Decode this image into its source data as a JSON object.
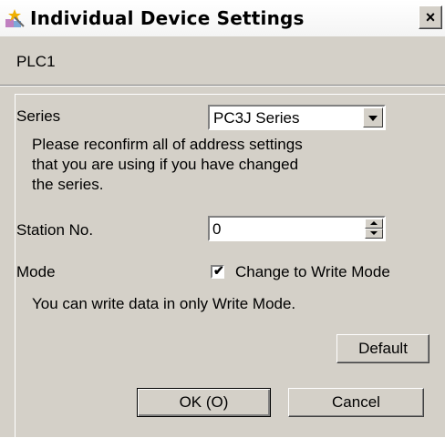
{
  "window": {
    "title": "Individual Device Settings",
    "close_glyph": "×"
  },
  "device": {
    "name": "PLC1"
  },
  "series": {
    "label": "Series",
    "selected": "PC3J Series",
    "note_lines": [
      "Please reconfirm all of address settings",
      "that you are using if you have changed",
      "the series."
    ]
  },
  "station": {
    "label": "Station No.",
    "value": "0"
  },
  "mode": {
    "label": "Mode",
    "checkbox_label": "Change to Write Mode",
    "checked": true,
    "note": "You can write data in only Write Mode."
  },
  "buttons": {
    "default": "Default",
    "ok": "OK (O)",
    "cancel": "Cancel"
  },
  "icons": {
    "title": "settings-wand-icon",
    "close": "close-icon",
    "dropdown": "chevron-down-icon",
    "spin_up": "spin-up-icon",
    "spin_down": "spin-down-icon",
    "check": "checkmark-icon"
  },
  "colors": {
    "dialog_bg": "#d4d0c8",
    "title_bg": "#ffffff"
  }
}
